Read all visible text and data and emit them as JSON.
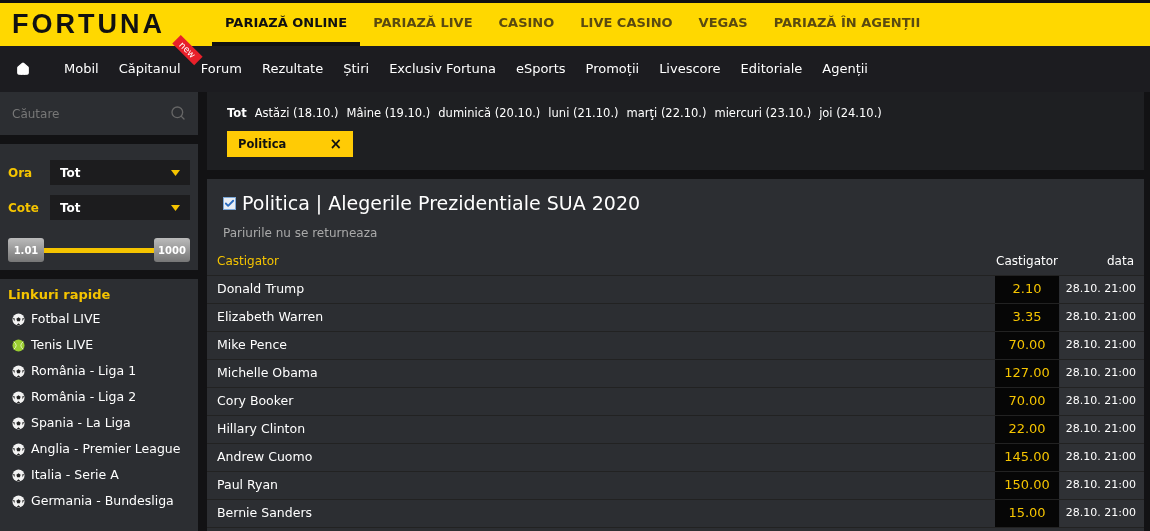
{
  "logo": "FORTUNA",
  "top_nav": [
    {
      "label": "PARIAZĂ ONLINE",
      "selected": true
    },
    {
      "label": "PARIAZĂ LIVE",
      "selected": false
    },
    {
      "label": "CASINO",
      "selected": false
    },
    {
      "label": "LIVE CASINO",
      "selected": false
    },
    {
      "label": "VEGAS",
      "selected": false
    },
    {
      "label": "PARIAZĂ ÎN AGENȚII",
      "selected": false
    }
  ],
  "sub_nav": [
    {
      "label": "Mobil"
    },
    {
      "label": "Căpitanul",
      "badge": "new"
    },
    {
      "label": "Forum"
    },
    {
      "label": "Rezultate"
    },
    {
      "label": "Știri"
    },
    {
      "label": "Exclusiv Fortuna"
    },
    {
      "label": "eSports"
    },
    {
      "label": "Promoții"
    },
    {
      "label": "Livescore"
    },
    {
      "label": "Editoriale"
    },
    {
      "label": "Agenții"
    }
  ],
  "sidebar": {
    "search": {
      "placeholder": "Căutare"
    },
    "filters": [
      {
        "label": "Ora",
        "value": "Tot"
      },
      {
        "label": "Cote",
        "value": "Tot"
      }
    ],
    "odds_range": {
      "min": "1.01",
      "max": "1000",
      "level": 1
    },
    "quick_links_title": "Linkuri rapide",
    "quick_links": [
      {
        "label": "Fotbal LIVE",
        "kind": "football"
      },
      {
        "label": "Tenis LIVE",
        "kind": "tennis"
      },
      {
        "label": "România - Liga 1",
        "kind": "football"
      },
      {
        "label": "România - Liga 2",
        "kind": "football"
      },
      {
        "label": "Spania - La Liga",
        "kind": "football"
      },
      {
        "label": "Anglia - Premier League",
        "kind": "football"
      },
      {
        "label": "Italia - Serie A",
        "kind": "football"
      },
      {
        "label": "Germania - Bundesliga",
        "kind": "football"
      }
    ]
  },
  "date_filters": [
    {
      "label": "Tot",
      "selected": true
    },
    {
      "label": "Astăzi (18.10.)",
      "selected": false
    },
    {
      "label": "Mâine (19.10.)",
      "selected": false
    },
    {
      "label": "duminică (20.10.)",
      "selected": false
    },
    {
      "label": "luni (21.10.)",
      "selected": false
    },
    {
      "label": "marţi (22.10.)",
      "selected": false
    },
    {
      "label": "miercuri (23.10.)",
      "selected": false
    },
    {
      "label": "joi (24.10.)",
      "selected": false
    }
  ],
  "active_tag": {
    "label": "Politica",
    "close": "×"
  },
  "market": {
    "title": "Politica | Alegerile Prezidentiale SUA 2020",
    "checked": true,
    "note": "Pariurile nu se returneaza",
    "columns": [
      "Castigator",
      "Castigator",
      "data"
    ],
    "rows": [
      {
        "name": "Donald Trump",
        "odds": "2.10",
        "date": "28.10. 21:00"
      },
      {
        "name": "Elizabeth Warren",
        "odds": "3.35",
        "date": "28.10. 21:00"
      },
      {
        "name": "Mike Pence",
        "odds": "70.00",
        "date": "28.10. 21:00"
      },
      {
        "name": "Michelle Obama",
        "odds": "127.00",
        "date": "28.10. 21:00"
      },
      {
        "name": "Cory Booker",
        "odds": "70.00",
        "date": "28.10. 21:00"
      },
      {
        "name": "Hillary Clinton",
        "odds": "22.00",
        "date": "28.10. 21:00"
      },
      {
        "name": "Andrew Cuomo",
        "odds": "145.00",
        "date": "28.10. 21:00"
      },
      {
        "name": "Paul Ryan",
        "odds": "150.00",
        "date": "28.10. 21:00"
      },
      {
        "name": "Bernie Sanders",
        "odds": "15.00",
        "date": "28.10. 21:00"
      }
    ]
  }
}
